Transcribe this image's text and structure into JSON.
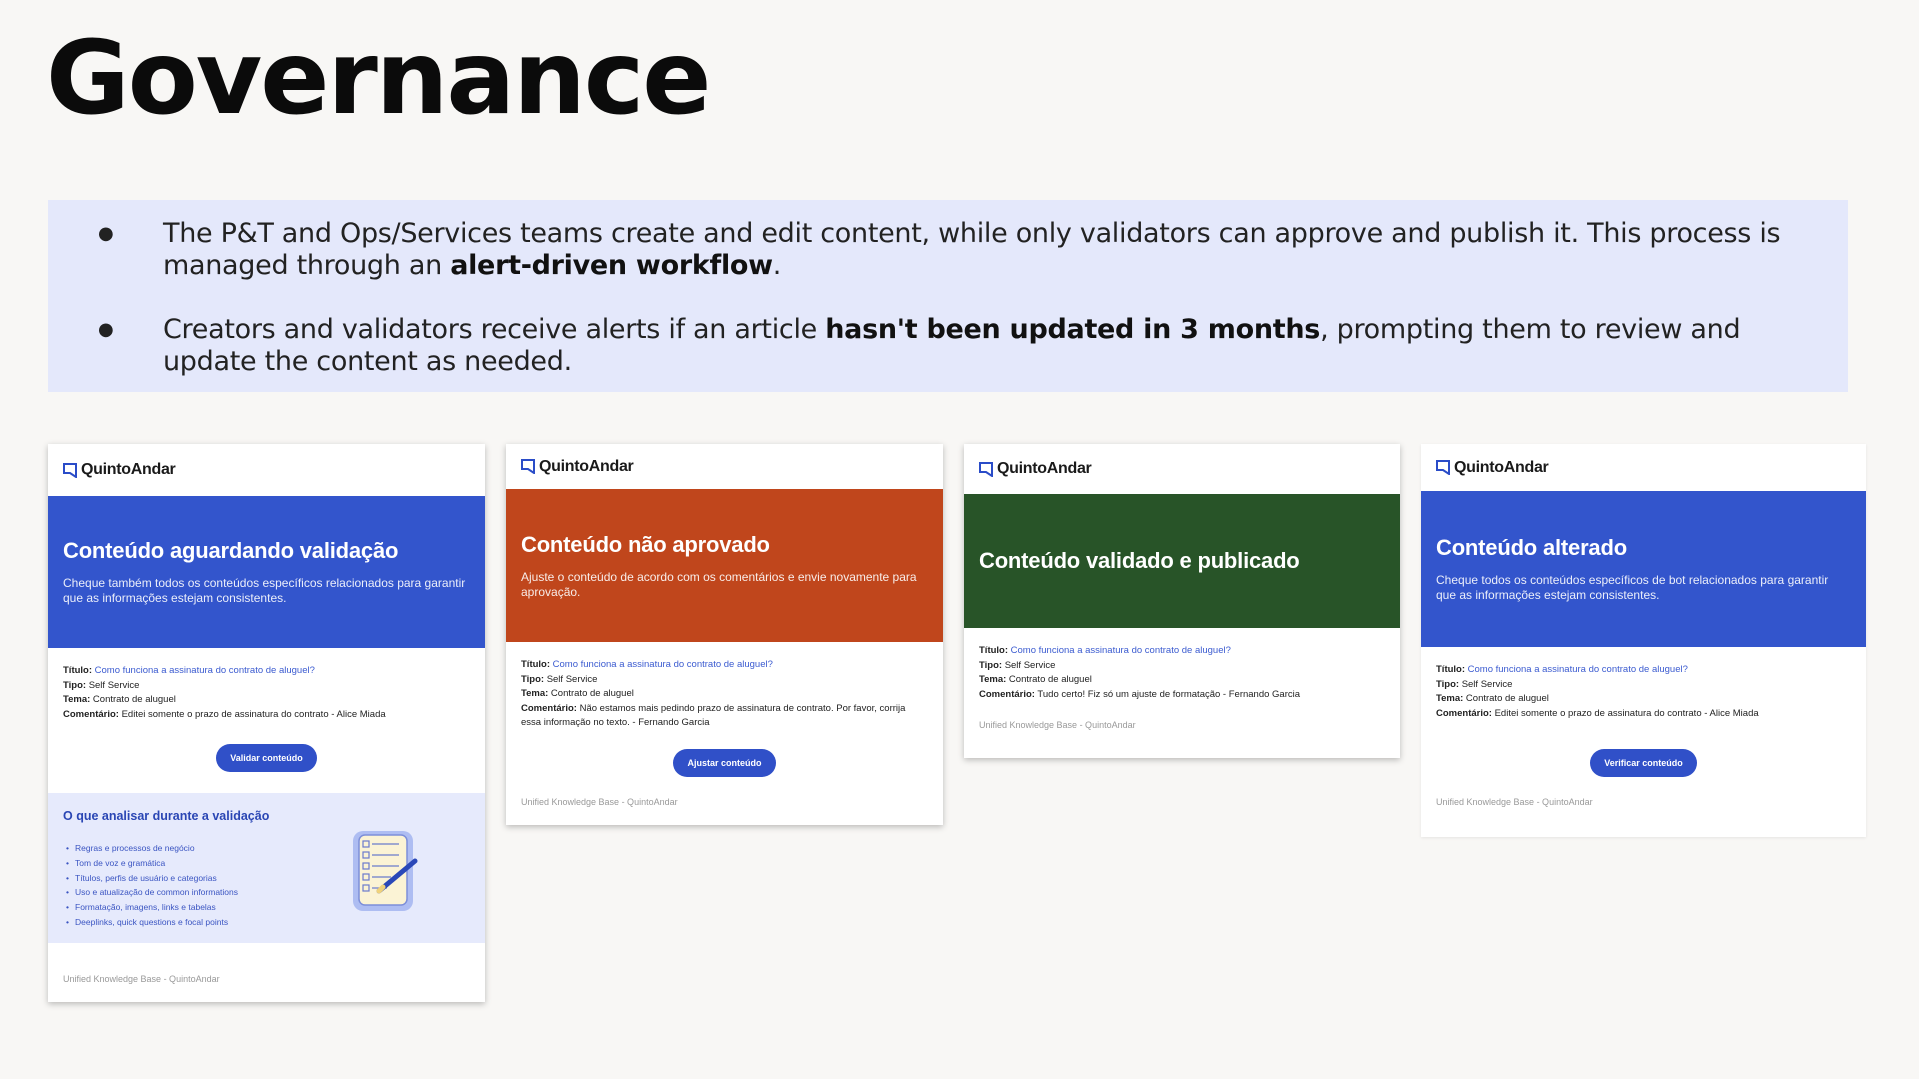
{
  "page": {
    "title": "Governance",
    "bullets": [
      {
        "before": "The P&T and Ops/Services teams create and edit content, while only validators can approve and publish it. This process is managed through an ",
        "bold": "alert-driven workflow",
        "after": "."
      },
      {
        "before": "Creators and validators receive alerts if an article ",
        "bold": "hasn't been updated in 3 months",
        "after": ", prompting them to review and update the content as needed."
      }
    ]
  },
  "brand": "QuintoAndar",
  "labels": {
    "titulo": "Título:",
    "tipo": "Tipo:",
    "tema": "Tema:",
    "comentario": "Comentário:"
  },
  "footer": "Unified Knowledge Base - QuintoAndar",
  "cards": [
    {
      "banner_color": "#3355cc",
      "heading": "Conteúdo aguardando validação",
      "subtext": "Cheque também todos os conteúdos específicos relacionados para garantir que as informações estejam consistentes.",
      "titulo": "Como funciona a assinatura do contrato de aluguel?",
      "tipo": "Self Service",
      "tema": "Contrato de aluguel",
      "comentario": "Editei somente o prazo de assinatura do contrato - Alice Miada",
      "button": "Validar conteúdo",
      "analyze_title": "O que analisar durante a validação",
      "analyze_items": [
        "Regras e processos de negócio",
        "Tom de voz e gramática",
        "Títulos, perfis de usuário e categorias",
        "Uso e atualização de common informations",
        "Formatação, imagens, links e tabelas",
        "Deeplinks, quick questions e focal points"
      ]
    },
    {
      "banner_color": "#c0461c",
      "heading": "Conteúdo não aprovado",
      "subtext": "Ajuste o conteúdo de acordo com os comentários e envie novamente para aprovação.",
      "titulo": "Como funciona a assinatura do contrato de aluguel?",
      "tipo": "Self Service",
      "tema": "Contrato de aluguel",
      "comentario": "Não estamos mais pedindo prazo de assinatura de contrato. Por favor, corrija essa informação no texto. - Fernando Garcia",
      "button": "Ajustar conteúdo"
    },
    {
      "banner_color": "#285428",
      "heading": "Conteúdo validado e publicado",
      "titulo": "Como funciona a assinatura do contrato de aluguel?",
      "tipo": "Self Service",
      "tema": "Contrato de aluguel",
      "comentario": "Tudo certo! Fiz só um ajuste de formatação - Fernando Garcia"
    },
    {
      "banner_color": "#3355cc",
      "heading": "Conteúdo alterado",
      "subtext": "Cheque todos os conteúdos específicos de bot relacionados para garantir que as informações estejam consistentes.",
      "titulo": "Como funciona a assinatura do contrato de aluguel?",
      "tipo": "Self Service",
      "tema": "Contrato de aluguel",
      "comentario": "Editei somente o prazo de assinatura do contrato - Alice Miada",
      "button": "Verificar conteúdo"
    }
  ]
}
